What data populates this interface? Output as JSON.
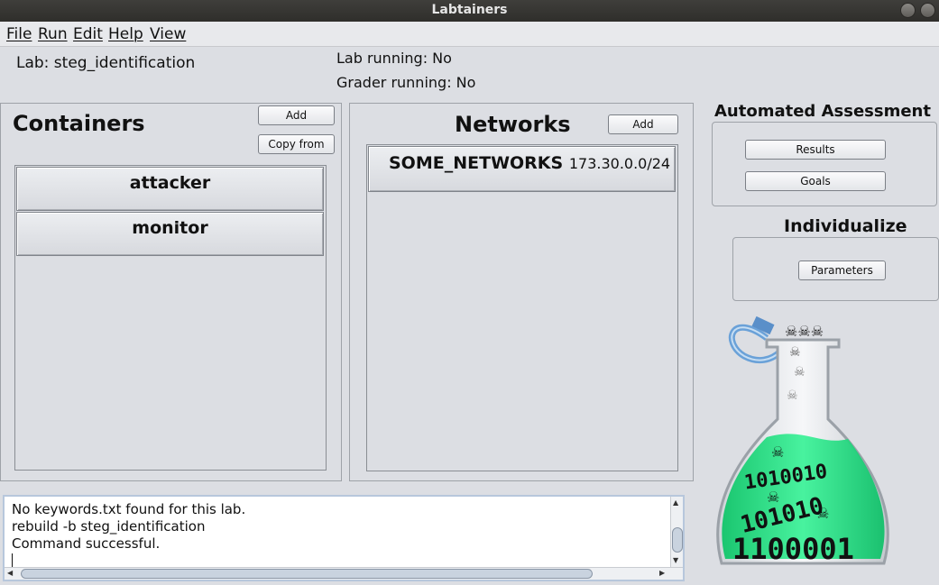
{
  "window": {
    "title": "Labtainers"
  },
  "menu": [
    "File",
    "Run",
    "Edit",
    "Help",
    "View"
  ],
  "lab": {
    "label": "Lab: steg_identification",
    "lab_running": "Lab running:  No",
    "grader_running": "Grader running:  No"
  },
  "containers": {
    "title": "Containers",
    "add_label": "Add",
    "copy_from_label": "Copy from",
    "items": [
      "attacker",
      "monitor"
    ]
  },
  "networks": {
    "title": "Networks",
    "add_label": "Add",
    "items": [
      {
        "name": "SOME_NETWORKS",
        "subnet": "173.30.0.0/24"
      }
    ]
  },
  "assessment": {
    "title": "Automated Assessment",
    "results_label": "Results",
    "goals_label": "Goals"
  },
  "individualize": {
    "title": "Individualize",
    "parameters_label": "Parameters"
  },
  "log": {
    "lines": [
      "No keywords.txt found for this lab.",
      "rebuild -b steg_identification",
      "Command successful."
    ]
  },
  "logo": {
    "binary_top": "1010010",
    "binary_mid": "101010",
    "binary_bottom": "1100001"
  }
}
